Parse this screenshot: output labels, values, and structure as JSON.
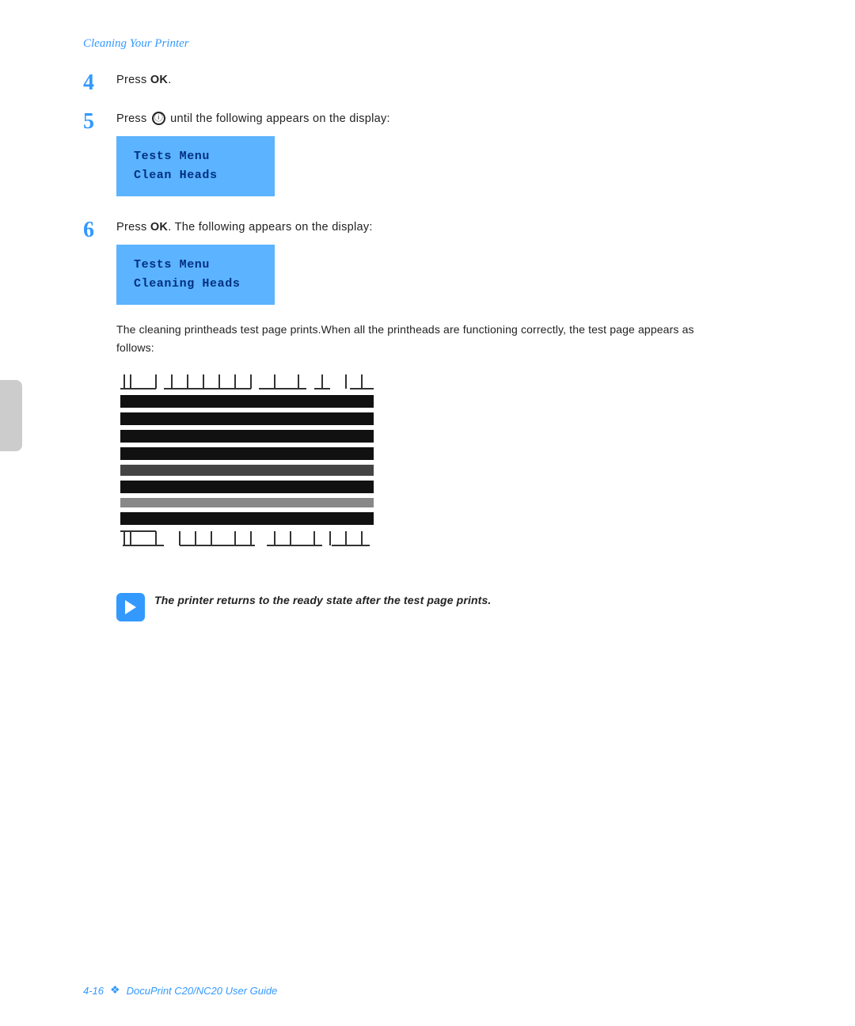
{
  "header": {
    "breadcrumb": "Cleaning Your Printer"
  },
  "footer": {
    "page_number": "4-16",
    "diamond": "❖",
    "guide_title": "DocuPrint C20/NC20 User Guide"
  },
  "steps": [
    {
      "number": "4",
      "text_before": "Press ",
      "bold": "OK",
      "text_after": "."
    },
    {
      "number": "5",
      "text_before": "Press ",
      "circle": "⊙",
      "text_after": " until the following appears on the display:"
    },
    {
      "number": "6",
      "text_before": "Press ",
      "bold": "OK",
      "text_after": ". The following appears on the display:"
    }
  ],
  "display_box_1": {
    "line1": "Tests Menu",
    "line2": "Clean  Heads"
  },
  "display_box_2": {
    "line1": "Tests Menu",
    "line2": "Cleaning Heads"
  },
  "body_text": "The cleaning printheads test page prints.When all the printheads are functioning correctly, the test page appears as follows:",
  "note": {
    "text_bold": "The printer returns to the ready state after the test page prints."
  }
}
